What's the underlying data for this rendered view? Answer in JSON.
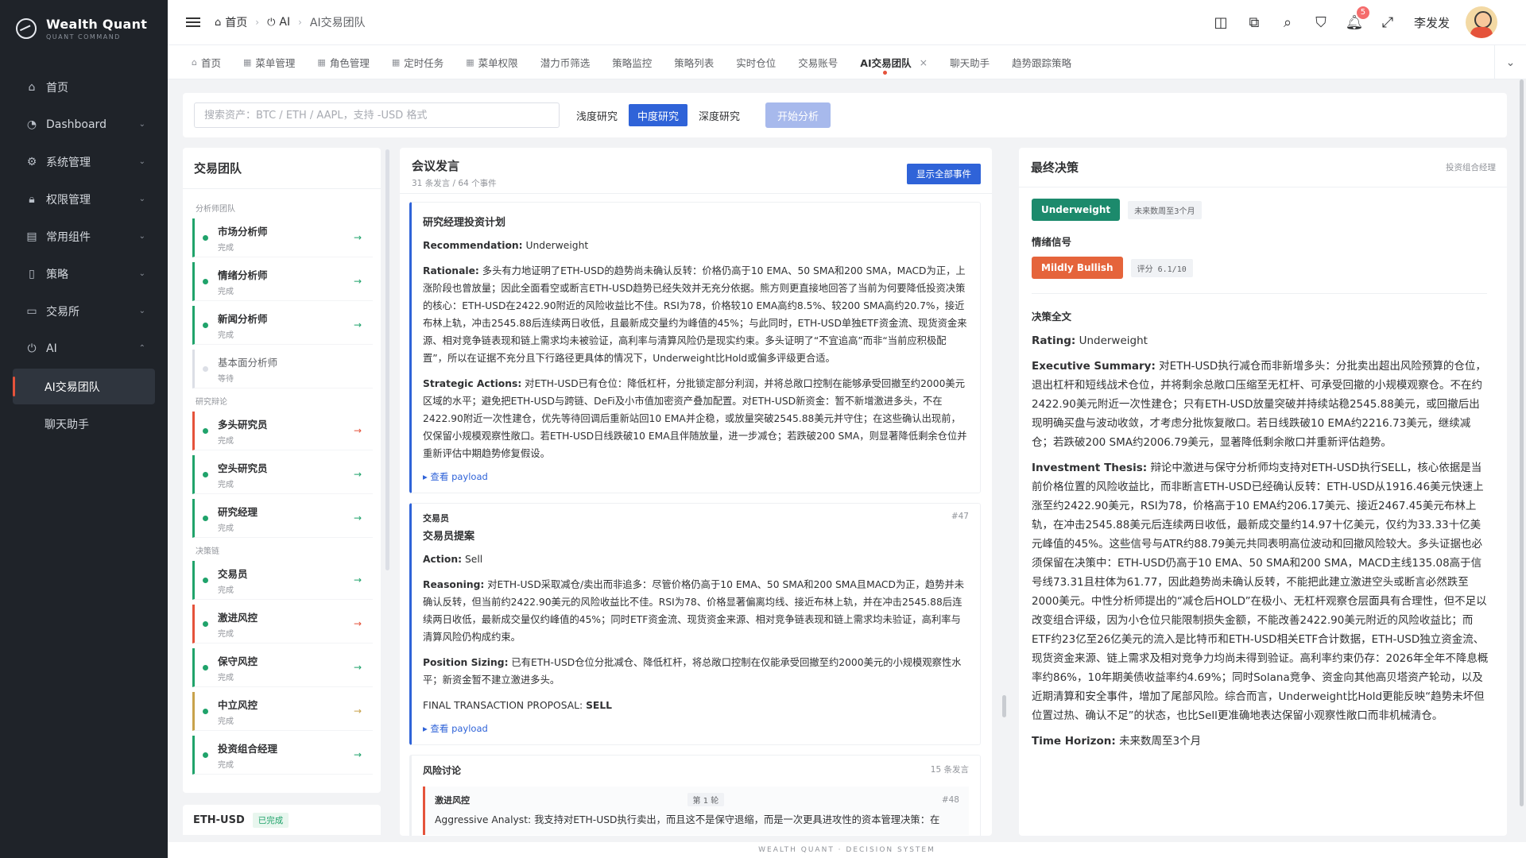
{
  "brand": {
    "title": "Wealth Quant",
    "subtitle": "QUANT COMMAND"
  },
  "sidebar": {
    "items": [
      {
        "label": "首页",
        "icon": "home-icon"
      },
      {
        "label": "Dashboard",
        "icon": "dashboard-icon"
      },
      {
        "label": "系统管理",
        "icon": "gear-icon"
      },
      {
        "label": "权限管理",
        "icon": "lock-icon"
      },
      {
        "label": "常用组件",
        "icon": "briefcase-icon"
      },
      {
        "label": "策略",
        "icon": "book-icon"
      },
      {
        "label": "交易所",
        "icon": "folder-icon"
      },
      {
        "label": "AI",
        "icon": "power-icon"
      }
    ],
    "sub_items": [
      {
        "label": "AI交易团队",
        "active": true
      },
      {
        "label": "聊天助手",
        "active": false
      }
    ]
  },
  "header": {
    "breadcrumb": [
      "首页",
      "AI",
      "AI交易团队"
    ],
    "notification_count": "5",
    "user_name": "李发发"
  },
  "tabs": [
    {
      "label": "首页",
      "icon": "home-icon"
    },
    {
      "label": "菜单管理",
      "icon": "grid-icon"
    },
    {
      "label": "角色管理",
      "icon": "grid-icon"
    },
    {
      "label": "定时任务",
      "icon": "grid-icon"
    },
    {
      "label": "菜单权限",
      "icon": "grid-icon"
    },
    {
      "label": "潜力币筛选",
      "icon": ""
    },
    {
      "label": "策略监控",
      "icon": ""
    },
    {
      "label": "策略列表",
      "icon": ""
    },
    {
      "label": "实时仓位",
      "icon": ""
    },
    {
      "label": "交易账号",
      "icon": ""
    },
    {
      "label": "AI交易团队",
      "icon": "",
      "active": true
    },
    {
      "label": "聊天助手",
      "icon": ""
    },
    {
      "label": "趋势跟踪策略",
      "icon": ""
    }
  ],
  "search": {
    "placeholder": "搜索资产：BTC / ETH / AAPL，支持 -USD 格式",
    "depths": [
      "浅度研究",
      "中度研究",
      "深度研究"
    ],
    "active_depth": "中度研究",
    "start_label": "开始分析"
  },
  "team": {
    "title": "交易团队",
    "groups": [
      {
        "label": "分析师团队",
        "members": [
          {
            "name": "市场分析师",
            "status": "完成",
            "accent": "green"
          },
          {
            "name": "情绪分析师",
            "status": "完成",
            "accent": "green"
          },
          {
            "name": "新闻分析师",
            "status": "完成",
            "accent": "green"
          },
          {
            "name": "基本面分析师",
            "status": "等待",
            "accent": "wait"
          }
        ]
      },
      {
        "label": "研究辩论",
        "members": [
          {
            "name": "多头研究员",
            "status": "完成",
            "accent": "red"
          },
          {
            "name": "空头研究员",
            "status": "完成",
            "accent": "green"
          },
          {
            "name": "研究经理",
            "status": "完成",
            "accent": "green"
          }
        ]
      },
      {
        "label": "决策链",
        "members": [
          {
            "name": "交易员",
            "status": "完成",
            "accent": "green"
          },
          {
            "name": "激进风控",
            "status": "完成",
            "accent": "red"
          },
          {
            "name": "保守风控",
            "status": "完成",
            "accent": "green"
          },
          {
            "name": "中立风控",
            "status": "完成",
            "accent": "gold"
          },
          {
            "name": "投资组合经理",
            "status": "完成",
            "accent": "green"
          }
        ]
      }
    ],
    "asset": "ETH-USD",
    "asset_status": "已完成"
  },
  "meeting": {
    "title": "会议发言",
    "stats": "31 条发言 / 64 个事件",
    "show_all_label": "显示全部事件",
    "plan_card": {
      "title": "研究经理投资计划",
      "recommendation_label": "Recommendation:",
      "recommendation": "Underweight",
      "rationale_label": "Rationale:",
      "rationale": "多头有力地证明了ETH-USD的趋势尚未确认反转：价格仍高于10 EMA、50 SMA和200 SMA，MACD为正，上涨阶段也曾放量；因此全面看空或断言ETH-USD趋势已经失效并无充分依据。熊方则更直接地回答了当前为何要降低投资决策的核心：ETH-USD在2422.90附近的风险收益比不佳。RSI为78，价格较10 EMA高约8.5%、较200 SMA高约20.7%，接近布林上轨，冲击2545.88后连续两日收低，且最新成交量约为峰值的45%；与此同时，ETH-USD单独ETF资金流、现货资金来源、相对竞争链表现和链上需求均未被验证，高利率与清算风险仍是现实约束。多头证明了“不宜追高”而非“当前应积极配置”，所以在证据不充分且下行路径更具体的情况下，Underweight比Hold或偏多评级更合适。",
      "actions_label": "Strategic Actions:",
      "actions": "对ETH-USD已有仓位：降低杠杆，分批锁定部分利润，并将总敞口控制在能够承受回撤至约2000美元区域的水平；避免把ETH-USD与跨链、DeFi及小市值加密资产叠加配置。对ETH-USD新资金：暂不新增激进多头，不在2422.90附近一次性建仓，优先等待回调后重新站回10 EMA并企稳，或放量突破2545.88美元并守住；在这些确认出现前，仅保留小规模观察性敞口。若ETH-USD日线跌破10 EMA且伴随放量，进一步减仓；若跌破200 SMA，则显著降低剩余仓位并重新评估中期趋势修复假设。",
      "payload_label": "▸ 查看 payload"
    },
    "trader_card": {
      "role": "交易员",
      "index": "#47",
      "title": "交易员提案",
      "action_label": "Action:",
      "action": "Sell",
      "reasoning_label": "Reasoning:",
      "reasoning": "对ETH-USD采取减仓/卖出而非追多：尽管价格仍高于10 EMA、50 SMA和200 SMA且MACD为正，趋势并未确认反转，但当前约2422.90美元的风险收益比不佳。RSI为78、价格显著偏离均线、接近布林上轨，并在冲击2545.88后连续两日收低，最新成交量仅约峰值的45%；同时ETF资金流、现货资金来源、相对竞争链表现和链上需求均未验证，高利率与清算风险仍构成约束。",
      "sizing_label": "Position Sizing:",
      "sizing": "已有ETH-USD仓位分批减仓、降低杠杆，将总敞口控制在仅能承受回撤至约2000美元的小规模观察性水平；新资金暂不建立激进多头。",
      "final_label": "FINAL TRANSACTION PROPOSAL:",
      "final_value": "SELL",
      "payload_label": "▸ 查看 payload"
    },
    "risk_card": {
      "title": "风险讨论",
      "count": "15 条发言",
      "item_role": "激进风控",
      "item_round": "第 1 轮",
      "item_index": "#48",
      "item_text": "Aggressive Analyst: 我支持对ETH-USD执行卖出，而且这不是保守退缩，而是一次更具进攻性的资本管理决策：在"
    }
  },
  "decision": {
    "title": "最终决策",
    "owner": "投资组合经理",
    "rating_badge": "Underweight",
    "horizon_badge": "未来数周至3个月",
    "sentiment_label": "情绪信号",
    "sentiment_badge": "Mildly Bullish",
    "score_badge": "评分 6.1/10",
    "full_text_label": "决策全文",
    "rating_label": "Rating:",
    "rating": "Underweight",
    "summary_label": "Executive Summary:",
    "summary": "对ETH-USD执行减仓而非新增多头：分批卖出超出风险预算的仓位，退出杠杆和短线战术仓位，并将剩余总敞口压缩至无杠杆、可承受回撤的小规模观察仓。不在约2422.90美元附近一次性建仓；只有ETH-USD放量突破并持续站稳2545.88美元，或回撤后出现明确买盘与波动收敛，才考虑分批恢复敞口。若日线跌破10 EMA约2216.73美元，继续减仓；若跌破200 SMA约2006.79美元，显著降低剩余敞口并重新评估趋势。",
    "thesis_label": "Investment Thesis:",
    "thesis": "辩论中激进与保守分析师均支持对ETH-USD执行SELL，核心依据是当前价格位置的风险收益比，而非断言ETH-USD已经确认反转：ETH-USD从1916.46美元快速上涨至约2422.90美元，RSI为78，价格高于10 EMA约206.17美元、接近2467.45美元布林上轨，在冲击2545.88美元后连续两日收低，最新成交量约14.97十亿美元，仅约为33.33十亿美元峰值的45%。这些信号与ATR约88.79美元共同表明高位波动和回撤风险较大。多头证据也必须保留在决策中：ETH-USD仍高于10 EMA、50 SMA和200 SMA，MACD主线135.08高于信号线73.31且柱体为61.77，因此趋势尚未确认反转，不能把此建立激进空头或断言必然跌至2000美元。中性分析师提出的“减仓后HOLD”在极小、无杠杆观察仓层面具有合理性，但不足以改变组合评级，因为小仓位只能限制损失金额，不能改善2422.90美元附近的风险收益比；而ETF约23亿至26亿美元的流入是比特币和ETH-USD相关ETF合计数据，ETH-USD独立资金流、现货资金来源、链上需求及相对竞争力均尚未得到验证。高利率约束仍存：2026年全年不降息概率约86%，10年期美债收益率约4.69%；同时Solana竞争、资金向其他高贝塔资产轮动，以及近期清算和安全事件，增加了尾部风险。综合而言，Underweight比Hold更能反映“趋势未坏但位置过热、确认不足”的状态，也比Sell更准确地表达保留小观察性敞口而非机械清仓。",
    "horizon_label": "Time Horizon:",
    "horizon": "未来数周至3个月"
  },
  "footer": {
    "text": "WEALTH QUANT · DECISION SYSTEM"
  }
}
